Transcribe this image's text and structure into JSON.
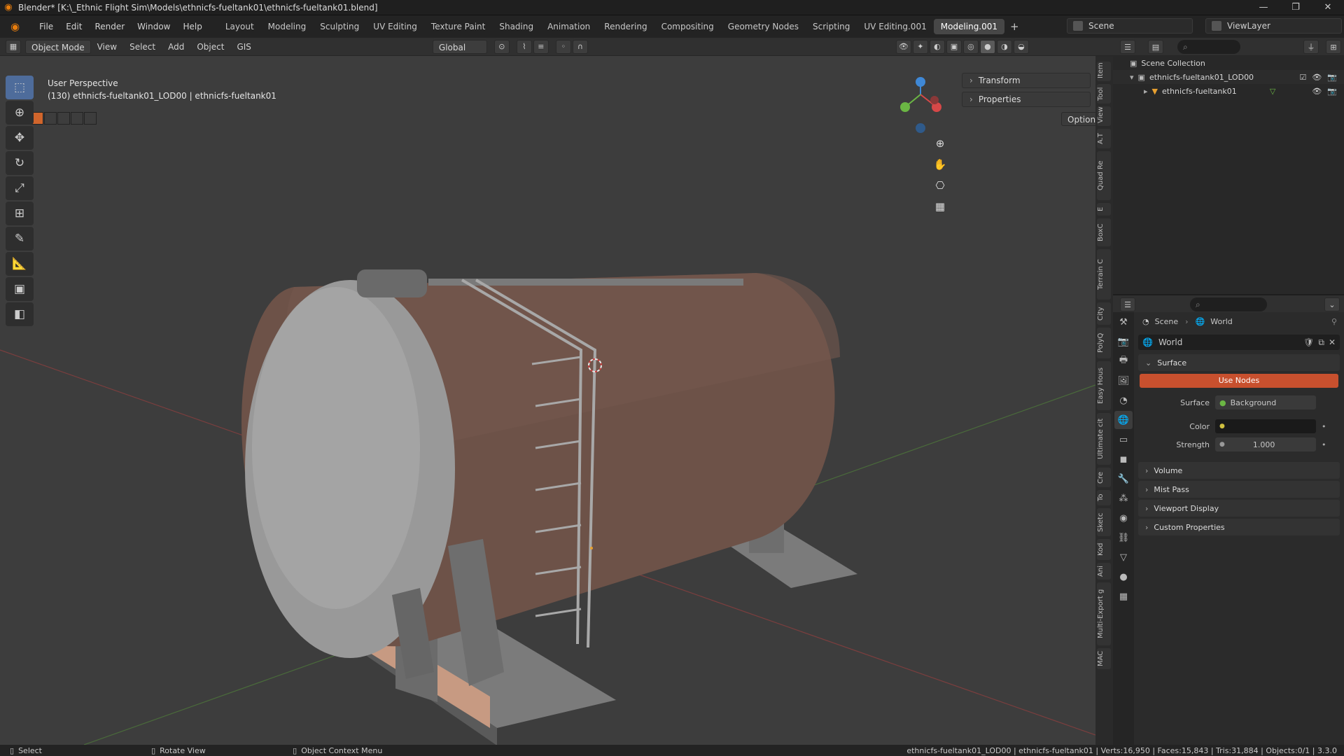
{
  "titlebar": {
    "title": "Blender* [K:\\_Ethnic Flight Sim\\Models\\ethnicfs-fueltank01\\ethnicfs-fueltank01.blend]",
    "minimize": "—",
    "restore": "❐",
    "close": "✕"
  },
  "menu": [
    "File",
    "Edit",
    "Render",
    "Window",
    "Help"
  ],
  "workspaces": [
    "Layout",
    "Modeling",
    "Sculpting",
    "UV Editing",
    "Texture Paint",
    "Shading",
    "Animation",
    "Rendering",
    "Compositing",
    "Geometry Nodes",
    "Scripting",
    "UV Editing.001",
    "Modeling.001"
  ],
  "active_workspace": "Modeling.001",
  "scene": "Scene",
  "view_layer": "ViewLayer",
  "viewport_header": {
    "mode": "Object Mode",
    "items": [
      "View",
      "Select",
      "Add",
      "Object",
      "GIS"
    ],
    "orientation": "Global",
    "options": "Options"
  },
  "viewport": {
    "perspective": "User Perspective",
    "object_info": "(130) ethnicfs-fueltank01_LOD00 | ethnicfs-fueltank01"
  },
  "npanel": {
    "transform": "Transform",
    "properties": "Properties"
  },
  "side_tabs": [
    "Item",
    "Tool",
    "View",
    "A.T",
    "Quad Re",
    "E",
    "BoxC",
    "Terrain C",
    "City",
    "PolyQ",
    "Easy Hous",
    "Ultimate cit",
    "Cre",
    "To",
    "Sketc",
    "Kod",
    "Ani",
    "Multi-Export g",
    "MAC"
  ],
  "outliner": {
    "root": "Scene Collection",
    "items": [
      {
        "label": "ethnicfs-fueltank01_LOD00",
        "level": 1
      },
      {
        "label": "ethnicfs-fueltank01",
        "level": 2
      }
    ]
  },
  "properties": {
    "breadcrumb": [
      "Scene",
      "World"
    ],
    "world_name": "World",
    "surface_section": "Surface",
    "use_nodes": "Use Nodes",
    "surface_label": "Surface",
    "surface_value": "Background",
    "color_label": "Color",
    "strength_label": "Strength",
    "strength_value": "1.000",
    "sections": [
      "Volume",
      "Mist Pass",
      "Viewport Display",
      "Custom Properties"
    ]
  },
  "statusbar": {
    "select": "Select",
    "rotate": "Rotate View",
    "context": "Object Context Menu",
    "stats": "ethnicfs-fueltank01_LOD00 | ethnicfs-fueltank01 | Verts:16,950 | Faces:15,843 | Tris:31,884 | Objects:0/1 | 3.3.0"
  },
  "colors": {
    "accent": "#e87d0d",
    "active_tool": "#4e6c9b",
    "use_nodes": "#c8502e",
    "axis_x": "#d74848",
    "axis_y": "#6bb644",
    "axis_z": "#3f88d6"
  }
}
